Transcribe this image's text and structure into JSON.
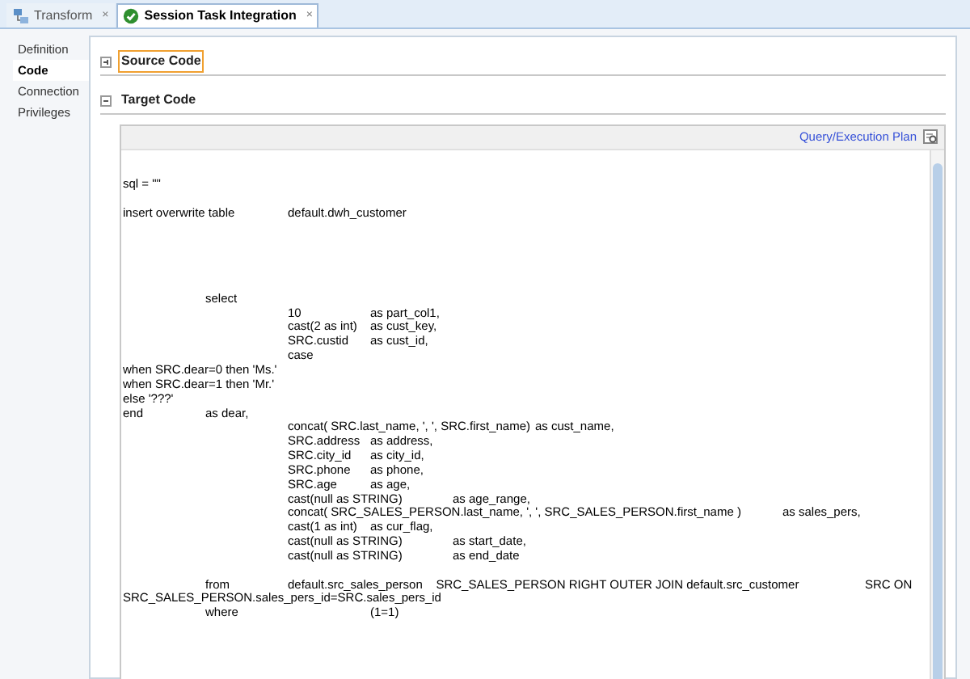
{
  "tabs": [
    {
      "label": "Transform",
      "close": "×",
      "kind": "transform",
      "selected": false
    },
    {
      "label": "Session Task Integration",
      "close": "×",
      "kind": "valid",
      "selected": true
    }
  ],
  "sidebar": {
    "items": [
      {
        "label": "Definition",
        "selected": false
      },
      {
        "label": "Code",
        "selected": true
      },
      {
        "label": "Connection",
        "selected": false
      },
      {
        "label": "Privileges",
        "selected": false
      }
    ]
  },
  "sections": [
    {
      "title": "Source Code",
      "expanded": false,
      "focused": true
    },
    {
      "title": "Target Code",
      "expanded": true,
      "focused": false,
      "link": "Query/Execution Plan",
      "code": "sql = \"\"\n\ninsert overwrite table\tdefault.dwh_customer\n\n\n\n\n\n\tselect\n\t\t10\tas part_col1,\n\t\tcast(2 as int)\tas cust_key,\n\t\tSRC.custid\tas cust_id,\n\t\tcase\nwhen SRC.dear=0 then 'Ms.'\nwhen SRC.dear=1 then 'Mr.'\nelse '???'\nend\tas dear,\n\t\tconcat( SRC.last_name, ', ', SRC.first_name)\tas cust_name,\n\t\tSRC.address\tas address,\n\t\tSRC.city_id\tas city_id,\n\t\tSRC.phone\tas phone,\n\t\tSRC.age\tas age,\n\t\tcast(null as STRING)\tas age_range,\n\t\tconcat( SRC_SALES_PERSON.last_name, ', ', SRC_SALES_PERSON.first_name )\tas sales_pers,\n\t\tcast(1 as int)\tas cur_flag,\n\t\tcast(null as STRING)\tas start_date,\n\t\tcast(null as STRING)\tas end_date\n\n\tfrom\tdefault.src_sales_person    SRC_SALES_PERSON RIGHT OUTER JOIN default.src_customer\tSRC ON\nSRC_SALES_PERSON.sales_pers_id=SRC.sales_pers_id\n\twhere\t\t(1=1)"
    }
  ]
}
